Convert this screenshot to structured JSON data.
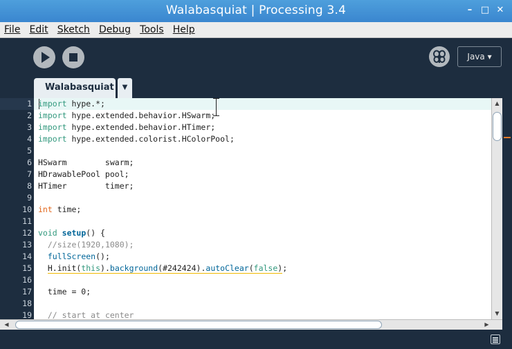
{
  "window": {
    "title": "Walabasquiat | Processing 3.4",
    "minimize": "–",
    "maximize": "□",
    "close": "✕"
  },
  "menu": [
    "File",
    "Edit",
    "Sketch",
    "Debug",
    "Tools",
    "Help"
  ],
  "toolbar": {
    "run_icon": "play-icon",
    "stop_icon": "stop-icon",
    "debug_icon": "debugger-butterfly-icon",
    "mode": "Java ▾"
  },
  "tabs": {
    "active": "Walabasquiat",
    "menu_icon": "▼"
  },
  "editor": {
    "current_line": 1,
    "line_numbers": [
      "1",
      "2",
      "3",
      "4",
      "5",
      "6",
      "7",
      "8",
      "9",
      "10",
      "11",
      "12",
      "13",
      "14",
      "15",
      "16",
      "17",
      "18",
      "19"
    ],
    "lines": [
      "import hype.*;",
      "import hype.extended.behavior.HSwarm;",
      "import hype.extended.behavior.HTimer;",
      "import hype.extended.colorist.HColorPool;",
      "",
      "HSwarm        swarm;",
      "HDrawablePool pool;",
      "HTimer        timer;",
      "",
      "int time;",
      "",
      "void setup() {",
      "  //size(1920,1080);",
      "  fullScreen();",
      "  H.init(this).background(#242424).autoClear(false);",
      "",
      "  time = 0;",
      "",
      "  // start at center"
    ],
    "colors": {
      "keyword": "#33997e",
      "type": "#e2661a",
      "function": "#006699",
      "comment": "#8a8a8a",
      "warning_underline": "#f0b900"
    }
  },
  "scrollbars": {
    "up": "▲",
    "down": "▼",
    "left": "◀",
    "right": "▶"
  },
  "theme": {
    "toolbar_bg": "#1d2d3f",
    "titlebar_bg": "#3f8fd2",
    "line_highlight": "#e8f7f6"
  }
}
